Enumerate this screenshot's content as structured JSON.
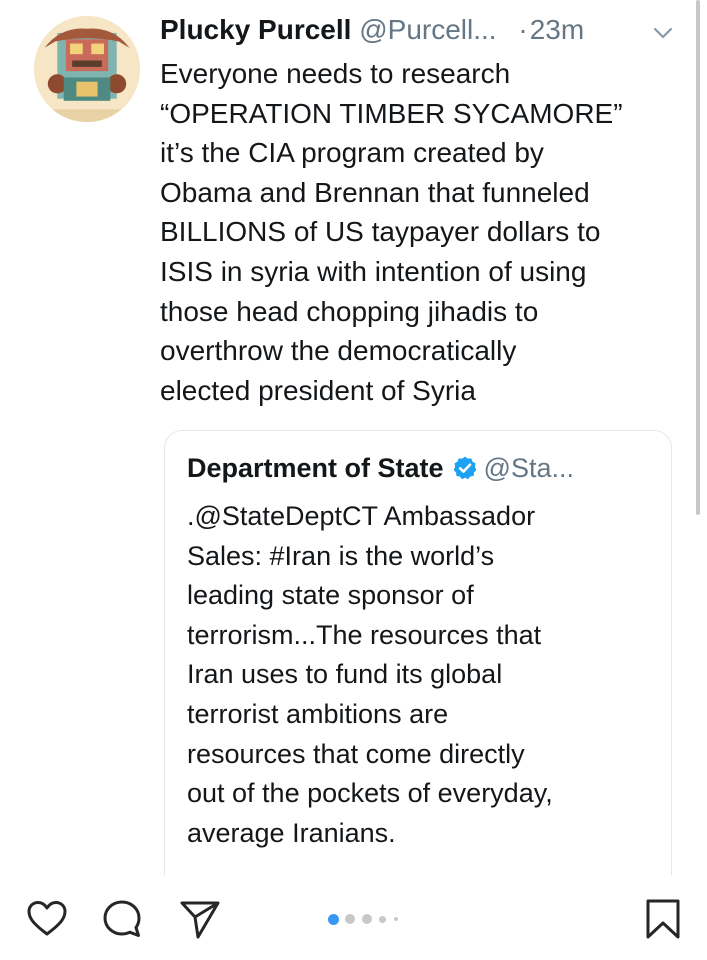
{
  "tweet": {
    "display_name": "Plucky Purcell",
    "handle": "@Purcell...",
    "separator": "·",
    "time": "23m",
    "text_lines": [
      "Everyone needs to research",
      "“OPERATION TIMBER SYCAMORE”",
      "it’s the CIA program created by",
      "Obama and Brennan that funneled",
      "BILLIONS of US taypayer dollars to",
      "ISIS in syria with intention of using",
      "those head chopping jihadis to",
      "overthrow the democratically",
      "elected president of Syria"
    ]
  },
  "quoted": {
    "display_name": "Department of State",
    "handle": "@Sta...",
    "text_lines": [
      ".@StateDeptCT Ambassador",
      "Sales: #Iran is the world’s",
      "leading state sponsor of",
      "terrorism...The resources that",
      "Iran uses to fund its global",
      "terrorist ambitions are",
      "resources that come directly",
      "out of the pockets of everyday,",
      "average Iranians."
    ]
  },
  "toolbar": {
    "icons": [
      "heart-icon",
      "comment-icon",
      "share-icon",
      "bookmark-icon"
    ],
    "carousel": {
      "total": 5,
      "active_index": 0
    }
  },
  "colors": {
    "text": "#14171a",
    "muted": "#657786",
    "verified": "#1da1f2",
    "carousel_active": "#3897f0",
    "border": "#e1e8ed"
  }
}
